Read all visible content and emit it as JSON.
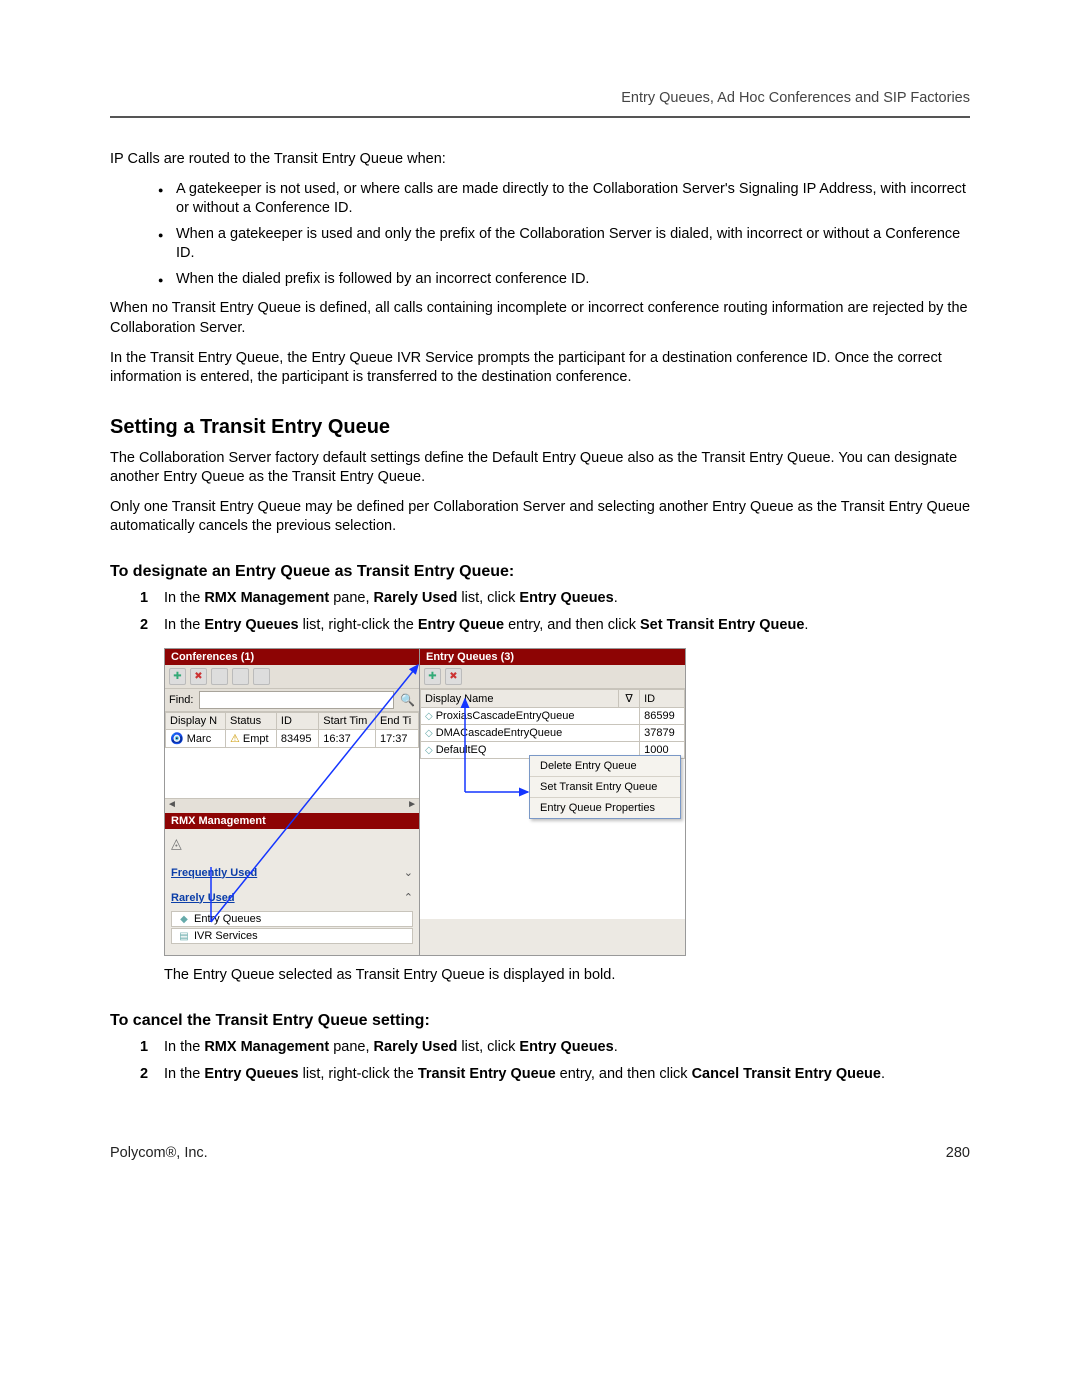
{
  "header": {
    "running_title": "Entry Queues, Ad Hoc Conferences and SIP Factories"
  },
  "intro": {
    "p1": "IP Calls are routed to the Transit Entry Queue when:",
    "bullets": [
      "A gatekeeper is not used, or where calls are made directly to the Collaboration Server's Signaling IP Address, with incorrect or without a Conference ID.",
      "When a gatekeeper is used and only the prefix of the Collaboration Server is dialed, with incorrect or without a Conference ID.",
      "When the dialed prefix is followed by an incorrect conference ID."
    ],
    "p2": "When no Transit Entry Queue is defined, all calls containing incomplete or incorrect conference routing information are rejected by the Collaboration Server.",
    "p3": "In the Transit Entry Queue, the Entry Queue IVR Service prompts the participant for a destination conference ID. Once the correct information is entered, the participant is transferred to the destination conference."
  },
  "section": {
    "title": "Setting a Transit Entry Queue",
    "p1": "The Collaboration Server factory default settings define the Default Entry Queue also as the Transit Entry Queue. You can designate another Entry Queue as the Transit Entry Queue.",
    "p2": "Only one Transit Entry Queue may be defined per Collaboration Server and selecting another Entry Queue as the Transit Entry Queue automatically cancels the previous selection."
  },
  "designate": {
    "title": "To designate an Entry Queue as Transit Entry Queue:",
    "step1": {
      "pre": "In the ",
      "b1": "RMX Management",
      "mid1": " pane, ",
      "b2": "Rarely Used",
      "mid2": " list, click ",
      "b3": "Entry Queues",
      "post": "."
    },
    "step2": {
      "pre": "In the ",
      "b1": "Entry Queues",
      "mid1": " list, right-click the ",
      "b2": "Entry Queue",
      "mid2": " entry, and then click ",
      "b3": "Set Transit Entry Queue",
      "post": "."
    },
    "after": "The Entry Queue selected as Transit Entry Queue is displayed in bold."
  },
  "cancel": {
    "title": "To cancel the Transit Entry Queue setting:",
    "step1": {
      "pre": "In the ",
      "b1": "RMX Management",
      "mid1": " pane, ",
      "b2": "Rarely Used",
      "mid2": " list, click ",
      "b3": "Entry Queues",
      "post": "."
    },
    "step2": {
      "pre": "In the ",
      "b1": "Entry Queues",
      "mid1": " list, right-click the ",
      "b2": "Transit Entry Queue",
      "mid2": " entry, and then click ",
      "b3": "Cancel Transit Entry Queue",
      "post": "."
    }
  },
  "screenshot": {
    "conferences": {
      "title": "Conferences (1)",
      "find_label": "Find:",
      "cols": [
        "Display N",
        "Status",
        "ID",
        "Start Tim",
        "End Ti"
      ],
      "row": {
        "name": "Marc",
        "status": "Empt",
        "id": "83495",
        "start": "16:37",
        "end": "17:37"
      }
    },
    "mgmt": {
      "title": "RMX Management",
      "freq": "Frequently Used",
      "rare": "Rarely Used",
      "items": [
        "Entry Queues",
        "IVR Services"
      ]
    },
    "eq": {
      "title": "Entry Queues (3)",
      "cols": [
        "Display Name",
        "ID"
      ],
      "rows": [
        {
          "name": "ProxiasCascadeEntryQueue",
          "id": "86599"
        },
        {
          "name": "DMACascadeEntryQueue",
          "id": "37879"
        },
        {
          "name": "DefaultEQ",
          "id": "1000"
        }
      ],
      "menu": [
        "Delete Entry Queue",
        "Set Transit Entry Queue",
        "Entry Queue Properties"
      ]
    }
  },
  "footer": {
    "left": "Polycom®, Inc.",
    "right": "280"
  }
}
